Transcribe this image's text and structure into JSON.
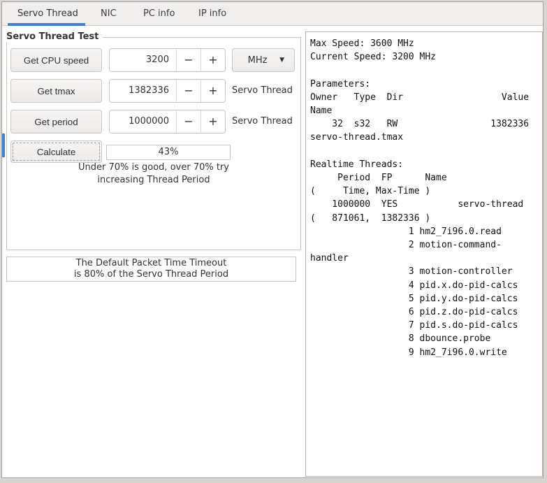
{
  "colors": {
    "accent": "#3584e4"
  },
  "tabs": [
    {
      "label": "Servo Thread",
      "active": true
    },
    {
      "label": "NIC",
      "active": false
    },
    {
      "label": "PC info",
      "active": false
    },
    {
      "label": "IP info",
      "active": false
    }
  ],
  "icons": {
    "minus": "−",
    "plus": "+",
    "dropdown": "▼"
  },
  "servo_test": {
    "title": "Servo Thread Test",
    "rows": [
      {
        "button": "Get CPU speed",
        "value": "3200",
        "unit": "MHz"
      },
      {
        "button": "Get tmax",
        "value": "1382336",
        "label": "Servo Thread"
      },
      {
        "button": "Get period",
        "value": "1000000",
        "label": "Servo Thread"
      }
    ],
    "calculate_button": "Calculate",
    "result_value": "43%",
    "hint_line1": "Under 70% is good, over 70% try",
    "hint_line2": "increasing Thread Period"
  },
  "timeout_frame": {
    "line1": "The Default Packet Time Timeout",
    "line2": "is 80% of the Servo Thread Period"
  },
  "output": {
    "lines": [
      "Max Speed: 3600 MHz",
      "Current Speed: 3200 MHz",
      "",
      "Parameters:",
      "Owner   Type  Dir                  Value",
      "Name",
      "    32  s32   RW                 1382336",
      "servo-thread.tmax",
      "",
      "Realtime Threads:",
      "     Period  FP      Name",
      "(     Time, Max-Time )",
      "    1000000  YES           servo-thread",
      "(   871061,  1382336 )",
      "                  1 hm2_7i96.0.read",
      "                  2 motion-command-",
      "handler",
      "                  3 motion-controller",
      "                  4 pid.x.do-pid-calcs",
      "                  5 pid.y.do-pid-calcs",
      "                  6 pid.z.do-pid-calcs",
      "                  7 pid.s.do-pid-calcs",
      "                  8 dbounce.probe",
      "                  9 hm2_7i96.0.write"
    ]
  }
}
